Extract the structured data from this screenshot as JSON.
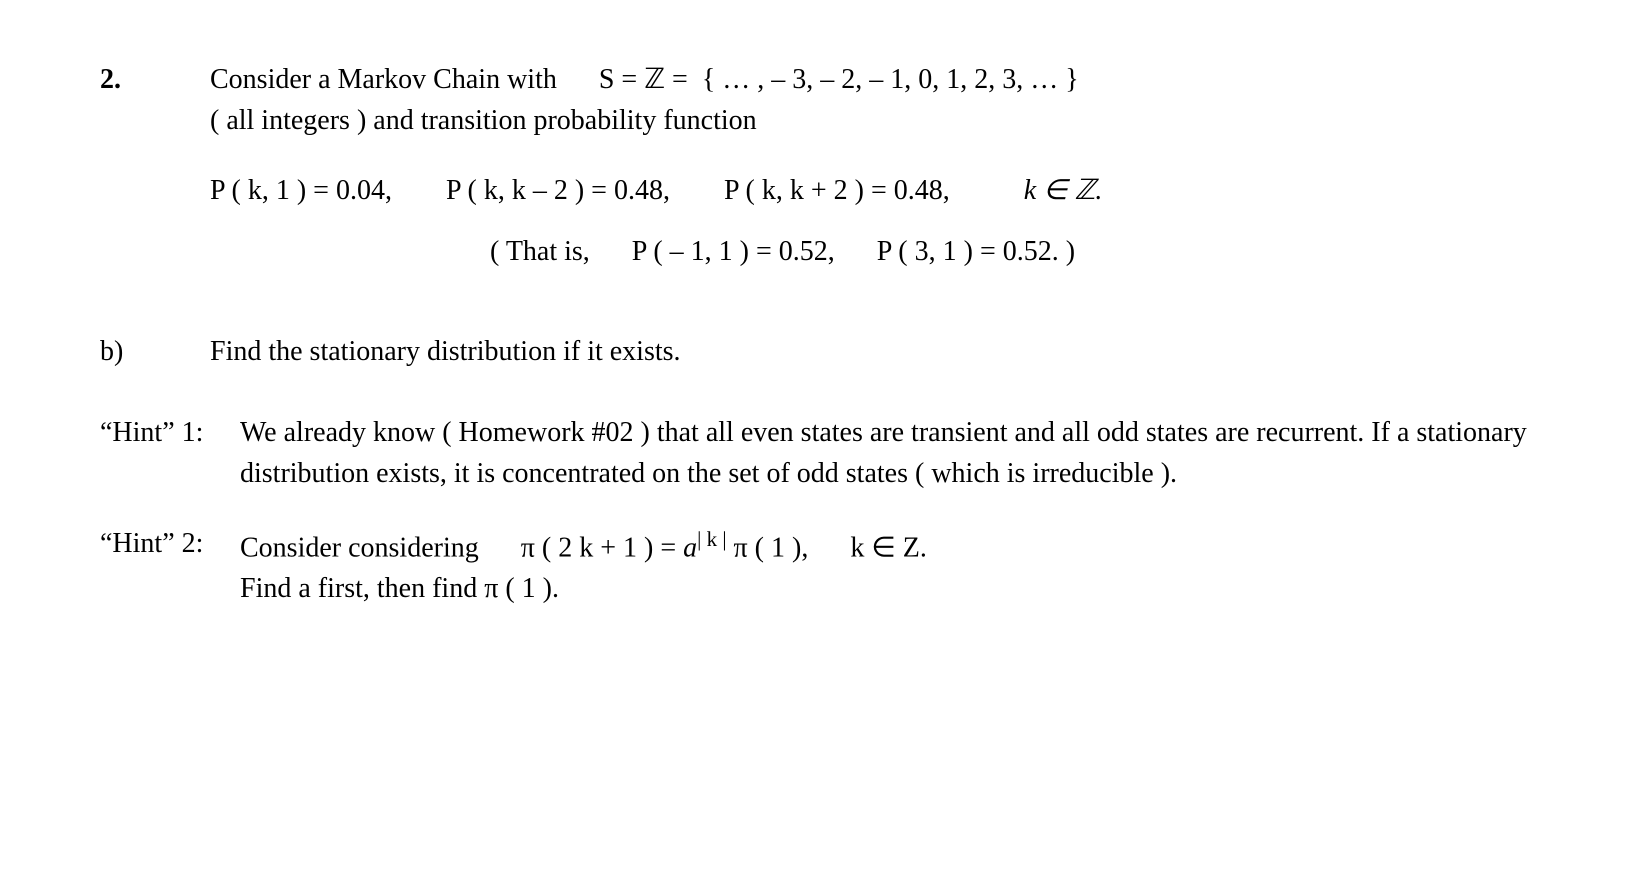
{
  "problem": {
    "number": "2.",
    "intro_line1": "Consider a Markov Chain with   S = ℤ =  { … , – 3, – 2, – 1, 0, 1, 2, 3, … }",
    "intro_line2": "( all integers )  and transition probability function",
    "eq_p1": "P ( k, 1 ) = 0.04,",
    "eq_p2": "P ( k, k – 2 ) = 0.48,",
    "eq_p3": "P ( k, k + 2 ) = 0.48,",
    "eq_p4": "k ∈ ℤ.",
    "note": "( That is,   P ( – 1, 1 ) = 0.52,   P ( 3, 1 ) = 0.52. )"
  },
  "part_b": {
    "label": "b)",
    "text": "Find the stationary distribution if it exists."
  },
  "hint1": {
    "label": "“Hint” 1:",
    "text": "We already know ( Homework #02 ) that all even states are transient and all odd states are recurrent.  If a stationary distribution exists, it is concentrated on the set of odd states ( which is irreducible )."
  },
  "hint2": {
    "label": "“Hint” 2:",
    "line1_pre": "Consider considering   ",
    "line1_pi1": "π ( 2 k + 1 )  =  ",
    "line1_a": "a",
    "line1_exp": "| k |",
    "line1_pi2": " π ( 1 ),   k ∈ Z.",
    "line2": "Find  a  first,  then find  π ( 1 )."
  }
}
